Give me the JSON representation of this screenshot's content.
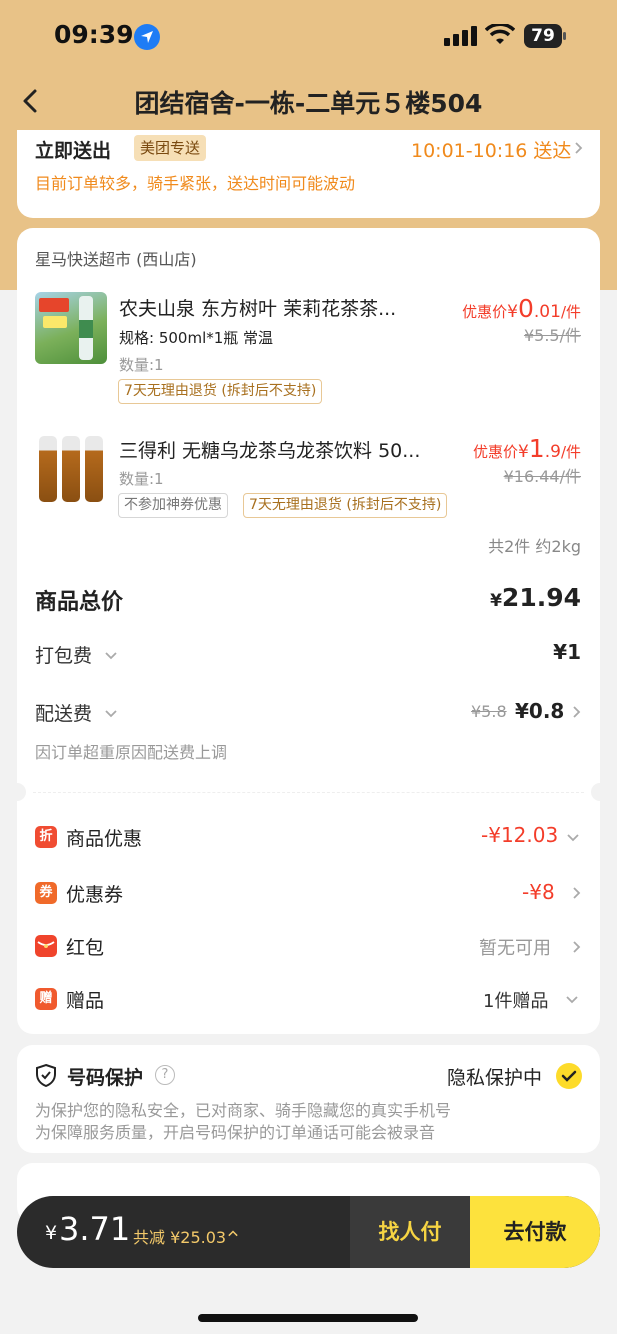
{
  "status_bar": {
    "time": "09:39",
    "battery": "79"
  },
  "nav": {
    "title": "团结宿舍-一栋-二单元５楼504"
  },
  "delivery": {
    "label": "立即送出",
    "badge": "美团专送",
    "window": "10:01-10:16 送达",
    "notice": "目前订单较多，骑手紧张，送达时间可能波动"
  },
  "store": {
    "name": "星马快送超市 (西山店)"
  },
  "items": [
    {
      "title": "农夫山泉 东方树叶 茉莉花茶茶...",
      "spec": "规格: 500ml*1瓶 常温",
      "qty": "数量:1",
      "price_label": "优惠价",
      "currency": "¥",
      "price_int": "0",
      "price_dec": ".01",
      "unit": "/件",
      "orig_price": "¥5.5/件",
      "tags": [
        "7天无理由退货 (拆封后不支持)"
      ]
    },
    {
      "title": "三得利 无糖乌龙茶乌龙茶饮料 50...",
      "qty": "数量:1",
      "price_label": "优惠价",
      "currency": "¥",
      "price_int": "1",
      "price_dec": ".9",
      "unit": "/件",
      "orig_price": "¥16.44/件",
      "tags": [
        "不参加神券优惠",
        "7天无理由退货 (拆封后不支持)"
      ]
    }
  ],
  "summary": {
    "count_weight": "共2件 约2kg",
    "subtotal_label": "商品总价",
    "subtotal_currency": "¥",
    "subtotal_value": "21.94",
    "packing_label": "打包费",
    "packing_value": "¥1",
    "delivery_label": "配送费",
    "delivery_orig": "¥5.8",
    "delivery_value": "¥0.8",
    "delivery_note": "因订单超重原因配送费上调"
  },
  "discounts": [
    {
      "icon_char": "折",
      "label": "商品优惠",
      "value": "-¥12.03"
    },
    {
      "icon_char": "券",
      "label": "优惠券",
      "value": "-¥8"
    },
    {
      "label": "红包",
      "value": "暂无可用"
    },
    {
      "icon_char": "赠",
      "label": "赠品",
      "value": "1件赠品"
    }
  ],
  "privacy": {
    "title": "号码保护",
    "help_char": "?",
    "status": "隐私保护中",
    "line1": "为保护您的隐私安全，已对商家、骑手隐藏您的真实手机号",
    "line2": "为保障服务质量，开启号码保护的订单通话可能会被录音"
  },
  "pay_bar": {
    "currency": "¥",
    "total": "3.71",
    "saved": "共减 ¥25.03",
    "friend_pay": "找人付",
    "pay": "去付款"
  },
  "colors": {
    "header": "#e8c287",
    "accent_red": "#f33d2a",
    "pay_yellow": "#fde23d",
    "friend_bg": "#3a3a3a"
  }
}
